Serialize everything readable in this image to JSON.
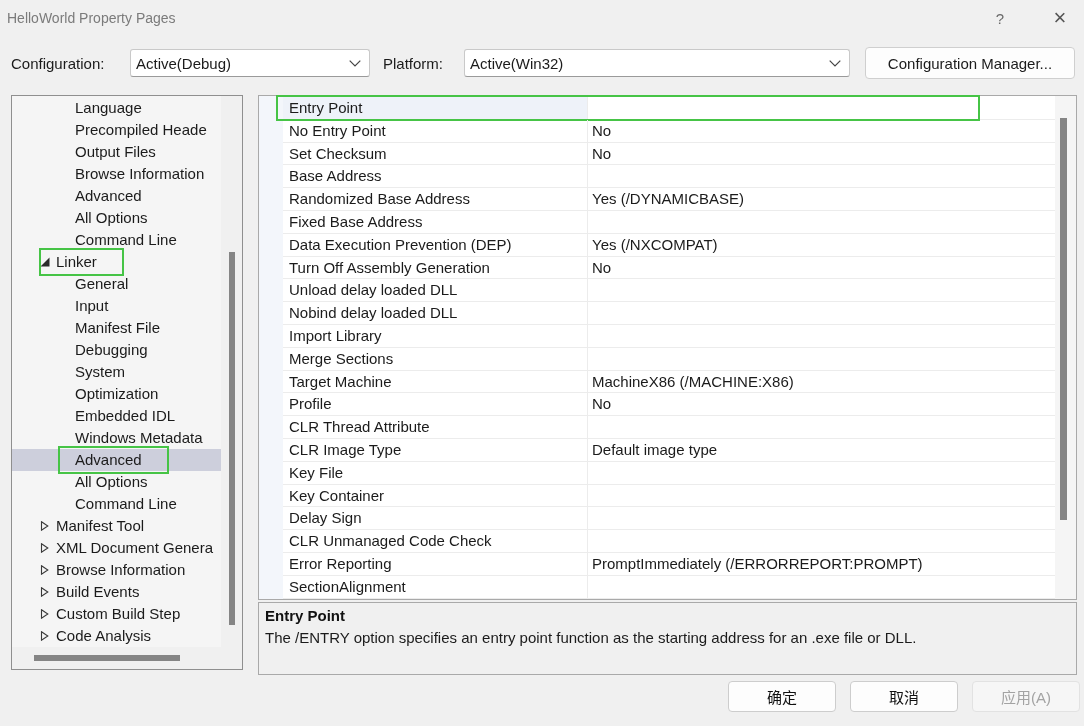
{
  "window": {
    "title": "HelloWorld Property Pages",
    "help": "?",
    "close": "×"
  },
  "toolbar": {
    "configuration": {
      "label": "Configuration:",
      "value": "Active(Debug)"
    },
    "platform": {
      "label": "Platform:",
      "value": "Active(Win32)"
    },
    "manager_button": "Configuration Manager..."
  },
  "tree": {
    "items": [
      {
        "children": [
          {
            "label": "Language",
            "selected": false,
            "highlighted": false
          },
          {
            "label": "Precompiled Heade",
            "selected": false,
            "highlighted": false
          },
          {
            "label": "Output Files",
            "selected": false,
            "highlighted": false
          },
          {
            "label": "Browse Information",
            "selected": false,
            "highlighted": false
          },
          {
            "label": "Advanced",
            "selected": false,
            "highlighted": false
          },
          {
            "label": "All Options",
            "selected": false,
            "highlighted": false
          },
          {
            "label": "Command Line",
            "selected": false,
            "highlighted": false
          }
        ]
      },
      {
        "label": "Linker",
        "expanded": true,
        "selected": false,
        "highlighted": true,
        "children": [
          {
            "label": "General",
            "selected": false,
            "highlighted": false
          },
          {
            "label": "Input",
            "selected": false,
            "highlighted": false
          },
          {
            "label": "Manifest File",
            "selected": false,
            "highlighted": false
          },
          {
            "label": "Debugging",
            "selected": false,
            "highlighted": false
          },
          {
            "label": "System",
            "selected": false,
            "highlighted": false
          },
          {
            "label": "Optimization",
            "selected": false,
            "highlighted": false
          },
          {
            "label": "Embedded IDL",
            "selected": false,
            "highlighted": false
          },
          {
            "label": "Windows Metadata",
            "selected": false,
            "highlighted": false
          },
          {
            "label": "Advanced",
            "selected": true,
            "highlighted": true
          },
          {
            "label": "All Options",
            "selected": false,
            "highlighted": false
          },
          {
            "label": "Command Line",
            "selected": false,
            "highlighted": false
          }
        ]
      },
      {
        "label": "Manifest Tool",
        "expanded": false,
        "selected": false,
        "highlighted": false
      },
      {
        "label": "XML Document Genera",
        "expanded": false,
        "selected": false,
        "highlighted": false
      },
      {
        "label": "Browse Information",
        "expanded": false,
        "selected": false,
        "highlighted": false
      },
      {
        "label": "Build Events",
        "expanded": false,
        "selected": false,
        "highlighted": false
      },
      {
        "label": "Custom Build Step",
        "expanded": false,
        "selected": false,
        "highlighted": false
      },
      {
        "label": "Code Analysis",
        "expanded": false,
        "selected": false,
        "highlighted": false
      }
    ]
  },
  "grid": {
    "rows": [
      {
        "name": "Entry Point",
        "selected": true,
        "highlighted": true
      },
      {
        "name": "No Entry Point",
        "value": "No",
        "selected": false,
        "highlighted": false
      },
      {
        "name": "Set Checksum",
        "value": "No",
        "selected": false,
        "highlighted": false
      },
      {
        "name": "Base Address",
        "selected": false,
        "highlighted": false
      },
      {
        "name": "Randomized Base Address",
        "value": "Yes (/DYNAMICBASE)",
        "selected": false,
        "highlighted": false
      },
      {
        "name": "Fixed Base Address",
        "selected": false,
        "highlighted": false
      },
      {
        "name": "Data Execution Prevention (DEP)",
        "value": "Yes (/NXCOMPAT)",
        "selected": false,
        "highlighted": false
      },
      {
        "name": "Turn Off Assembly Generation",
        "value": "No",
        "selected": false,
        "highlighted": false
      },
      {
        "name": "Unload delay loaded DLL",
        "selected": false,
        "highlighted": false
      },
      {
        "name": "Nobind delay loaded DLL",
        "selected": false,
        "highlighted": false
      },
      {
        "name": "Import Library",
        "selected": false,
        "highlighted": false
      },
      {
        "name": "Merge Sections",
        "selected": false,
        "highlighted": false
      },
      {
        "name": "Target Machine",
        "value": "MachineX86 (/MACHINE:X86)",
        "selected": false,
        "highlighted": false
      },
      {
        "name": "Profile",
        "value": "No",
        "selected": false,
        "highlighted": false
      },
      {
        "name": "CLR Thread Attribute",
        "selected": false,
        "highlighted": false
      },
      {
        "name": "CLR Image Type",
        "value": "Default image type",
        "selected": false,
        "highlighted": false
      },
      {
        "name": "Key File",
        "selected": false,
        "highlighted": false
      },
      {
        "name": "Key Container",
        "selected": false,
        "highlighted": false
      },
      {
        "name": "Delay Sign",
        "selected": false,
        "highlighted": false
      },
      {
        "name": "CLR Unmanaged Code Check",
        "selected": false,
        "highlighted": false
      },
      {
        "name": "Error Reporting",
        "value": "PromptImmediately (/ERRORREPORT:PROMPT)",
        "selected": false,
        "highlighted": false
      },
      {
        "name": "SectionAlignment",
        "selected": false,
        "highlighted": false
      }
    ]
  },
  "description": {
    "title": "Entry Point",
    "text": "The /ENTRY option specifies an entry point function as the starting address for an .exe file or DLL."
  },
  "buttons": [
    {
      "label": "确定",
      "disabled": false
    },
    {
      "label": "取消",
      "disabled": false
    },
    {
      "label": "应用(A)",
      "disabled": true
    }
  ]
}
